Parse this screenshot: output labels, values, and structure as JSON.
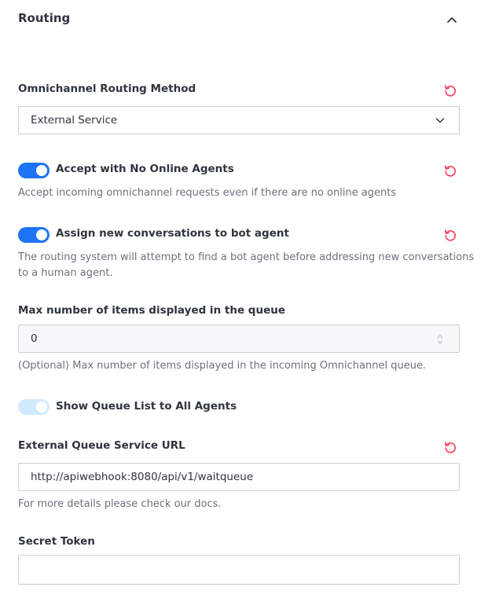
{
  "section": {
    "title": "Routing"
  },
  "routing_method": {
    "label": "Omnichannel Routing Method",
    "value": "External Service"
  },
  "accept_no_online": {
    "label": "Accept with No Online Agents",
    "hint": "Accept incoming omnichannel requests even if there are no online agents",
    "enabled": true
  },
  "assign_bot": {
    "label": "Assign new conversations to bot agent",
    "hint_line1": "The routing system will attempt to find a bot agent before addressing new conversations",
    "hint_line2": "to a human agent.",
    "enabled": true
  },
  "max_items": {
    "label": "Max number of items displayed in the queue",
    "value": "0",
    "hint": "(Optional) Max number of items displayed in the incoming Omnichannel queue."
  },
  "show_queue": {
    "label": "Show Queue List to All Agents",
    "enabled": true,
    "disabled": true
  },
  "queue_url": {
    "label": "External Queue Service URL",
    "value": "http://apiwebhook:8080/api/v1/waitqueue",
    "hint": "For more details please check our docs."
  },
  "secret_token": {
    "label": "Secret Token",
    "value": ""
  },
  "colors": {
    "accent": "#1d74f5",
    "reset": "#f5455c",
    "toggle_disabled": "#d1ebfe"
  }
}
